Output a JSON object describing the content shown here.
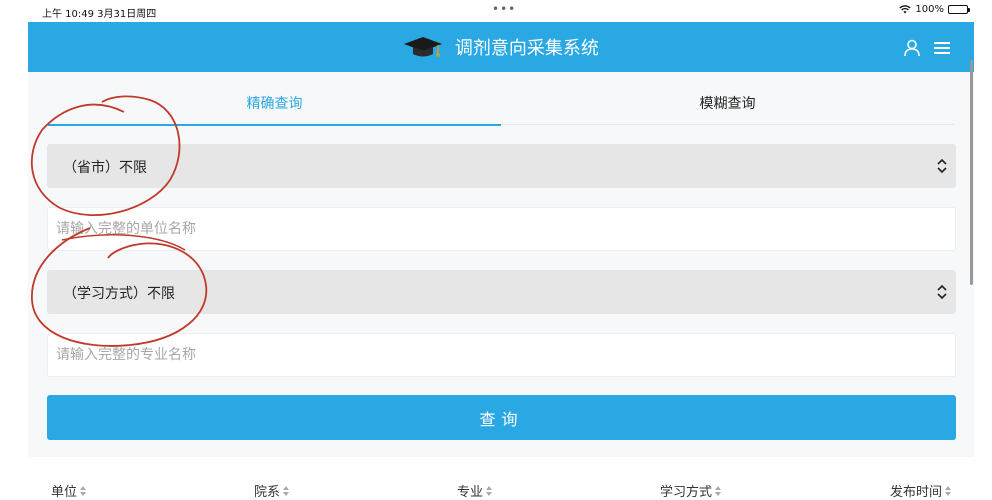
{
  "status_bar": {
    "time": "上午 10:49  3月31日周四",
    "battery": "100%"
  },
  "header": {
    "title": "调剂意向采集系统"
  },
  "tabs": [
    {
      "label": "精确查询",
      "active": true
    },
    {
      "label": "模糊查询",
      "active": false
    }
  ],
  "form": {
    "province_select": "（省市）不限",
    "unit_placeholder": "请输入完整的单位名称",
    "study_mode_select": "（学习方式）不限",
    "major_placeholder": "请输入完整的专业名称",
    "query_label": "查询"
  },
  "table": {
    "columns": [
      "单位",
      "院系",
      "专业",
      "学习方式",
      "发布时间"
    ]
  },
  "colors": {
    "primary": "#2aa8e4",
    "annotation": "#c0392b"
  }
}
